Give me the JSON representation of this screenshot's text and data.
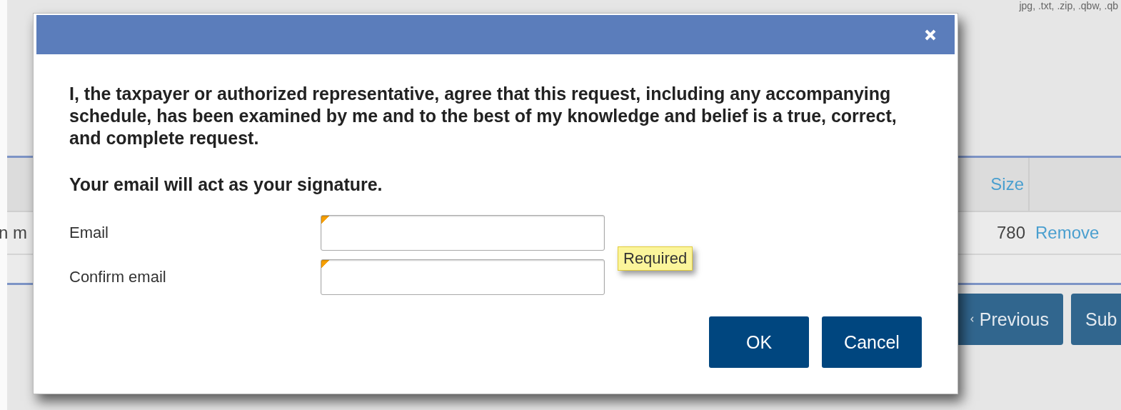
{
  "page": {
    "top_text": "jpg, .txt, .zip, .qbw, .qb",
    "table": {
      "columns": [
        {
          "label": "Size"
        }
      ],
      "rows": [
        {
          "column_1": "n m",
          "size": "780",
          "action": "Remove"
        }
      ]
    },
    "buttons": [
      {
        "label": "Previous",
        "kind": "back"
      },
      {
        "label": "Sub",
        "kind": "plain"
      }
    ]
  },
  "dialog": {
    "message": "I, the taxpayer or authorized representative, agree that this request, including any accompanying schedule, has been examined by me and to the best of my knowledge and belief is a true, correct, and complete request.",
    "note": "Your email will act as your signature.",
    "fields": [
      {
        "label": "Email",
        "required": true,
        "tooltip": "Required"
      },
      {
        "label": "Confirm email",
        "required": true
      }
    ],
    "buttons": [
      {
        "label": "OK"
      },
      {
        "label": "Cancel"
      }
    ]
  }
}
